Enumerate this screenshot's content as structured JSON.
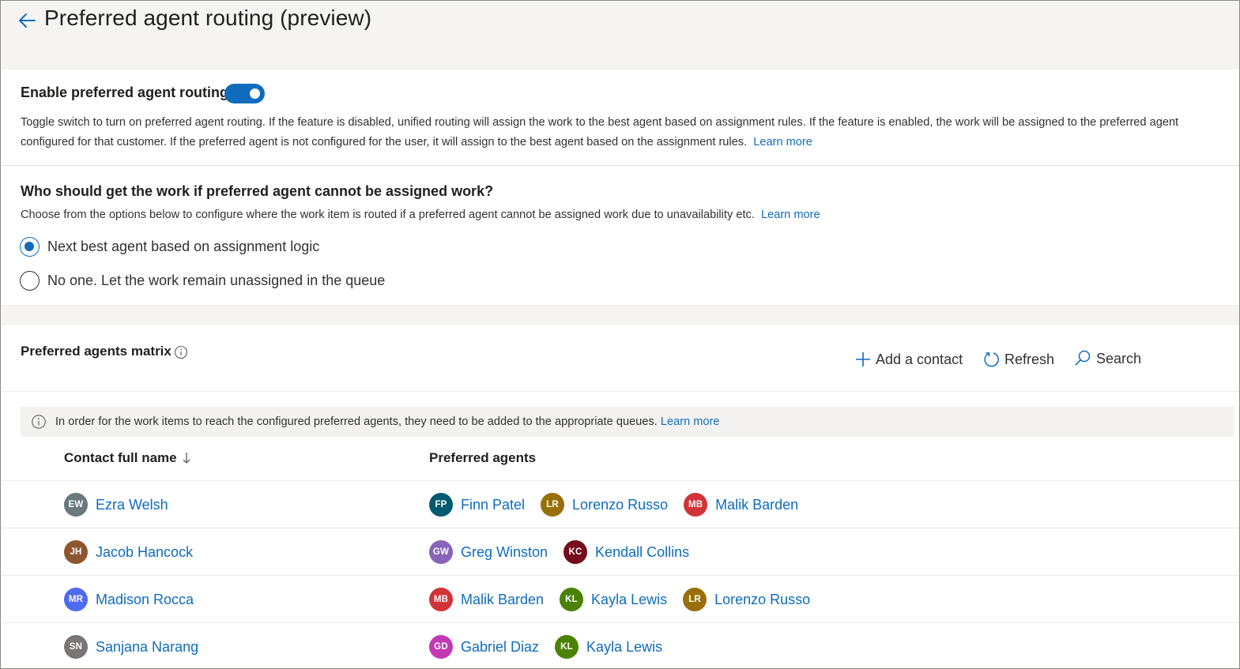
{
  "header": {
    "title": "Preferred agent routing (preview)",
    "back_icon": "back-arrow-icon"
  },
  "enable_section": {
    "label": "Enable preferred agent routing",
    "toggle_on": true,
    "description": "Toggle switch to turn on preferred agent routing. If the feature is disabled, unified routing will assign the work to the best agent based on assignment rules. If the feature is enabled, the work will be assigned to the preferred agent configured for that customer. If the preferred agent is not configured for the user, it will assign to the best agent based on the assignment rules.",
    "learn_more": "Learn more"
  },
  "fallback_section": {
    "title": "Who should get the work if preferred agent cannot be assigned work?",
    "description": "Choose from the options below to configure where the work item is routed if a preferred agent cannot be assigned work due to unavailability etc.",
    "learn_more": "Learn more",
    "options": [
      {
        "label": "Next best agent based on assignment logic",
        "selected": true
      },
      {
        "label": "No one. Let the work remain unassigned in the queue",
        "selected": false
      }
    ]
  },
  "matrix": {
    "title": "Preferred agents matrix",
    "commands": {
      "add": "Add a contact",
      "refresh": "Refresh",
      "search": "Search"
    },
    "banner": {
      "text": "In order for the work items to reach the configured preferred agents, they need to be added to the appropriate queues.",
      "learn_more": "Learn more"
    },
    "columns": {
      "contact": "Contact full name",
      "agents": "Preferred agents"
    },
    "rows": [
      {
        "contact": {
          "initials": "EW",
          "name": "Ezra Welsh",
          "color": "#69797e"
        },
        "agents": [
          {
            "initials": "FP",
            "name": "Finn Patel",
            "color": "#005b70"
          },
          {
            "initials": "LR",
            "name": "Lorenzo Russo",
            "color": "#986f0b"
          },
          {
            "initials": "MB",
            "name": "Malik Barden",
            "color": "#d13438"
          }
        ]
      },
      {
        "contact": {
          "initials": "JH",
          "name": "Jacob Hancock",
          "color": "#8e562e"
        },
        "agents": [
          {
            "initials": "GW",
            "name": "Greg Winston",
            "color": "#8764b8"
          },
          {
            "initials": "KC",
            "name": "Kendall Collins",
            "color": "#750b1c"
          }
        ]
      },
      {
        "contact": {
          "initials": "MR",
          "name": "Madison Rocca",
          "color": "#4f6bed"
        },
        "agents": [
          {
            "initials": "MB",
            "name": "Malik Barden",
            "color": "#d13438"
          },
          {
            "initials": "KL",
            "name": "Kayla Lewis",
            "color": "#498205"
          },
          {
            "initials": "LR",
            "name": "Lorenzo Russo",
            "color": "#986f0b"
          }
        ]
      },
      {
        "contact": {
          "initials": "SN",
          "name": "Sanjana Narang",
          "color": "#7a7574"
        },
        "agents": [
          {
            "initials": "GD",
            "name": "Gabriel Diaz",
            "color": "#c239b3"
          },
          {
            "initials": "KL",
            "name": "Kayla Lewis",
            "color": "#498205"
          }
        ]
      }
    ]
  },
  "colors": {
    "accent": "#0f6cbd",
    "header_bg": "#f5f4f3",
    "banner_bg": "#f3f2f1"
  }
}
